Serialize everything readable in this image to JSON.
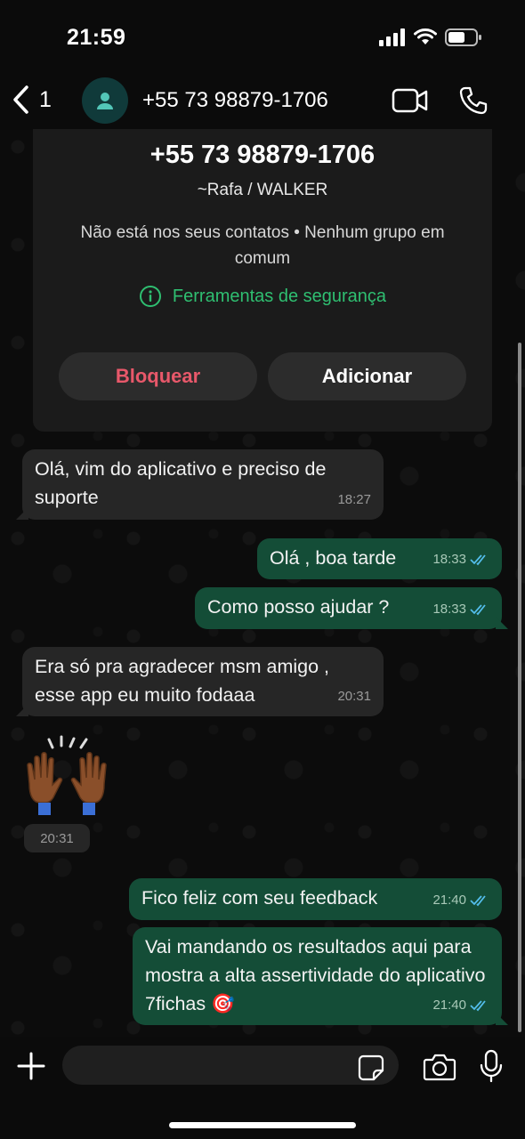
{
  "status_bar": {
    "time": "21:59"
  },
  "header": {
    "back_count": "1",
    "title": "+55 73 98879-1706",
    "icons": [
      "chevron-left-icon",
      "person-icon",
      "video-camera-icon",
      "phone-icon"
    ]
  },
  "info_card": {
    "phone": "+55 73 98879-1706",
    "name": "~Rafa / WALKER",
    "description": "Não está nos seus contatos • Nenhum grupo em comum",
    "security_label": "Ferramentas de segurança",
    "block_label": "Bloquear",
    "add_label": "Adicionar"
  },
  "messages": [
    {
      "direction": "in",
      "text": "Olá, vim do aplicativo e preciso de suporte",
      "time": "18:27"
    },
    {
      "direction": "out",
      "text": "Olá , boa tarde",
      "time": "18:33",
      "status": "read"
    },
    {
      "direction": "out",
      "text": "Como posso ajudar ?",
      "time": "18:33",
      "status": "read"
    },
    {
      "direction": "in",
      "text": "Era só pra agradecer msm amigo , esse app eu muito fodaaa",
      "time": "20:31"
    },
    {
      "direction": "in",
      "type": "emoji",
      "text": "🙌🏾",
      "time": "20:31"
    },
    {
      "direction": "out",
      "text": "Fico feliz com seu feedback",
      "time": "21:40",
      "status": "read"
    },
    {
      "direction": "out",
      "text": "Vai mandando os resultados aqui para mostra a alta assertividade do aplicativo 7fichas 🎯",
      "time": "21:40",
      "status": "read"
    }
  ],
  "input_bar": {
    "placeholder": "",
    "icons": [
      "plus-icon",
      "sticker-icon",
      "camera-icon",
      "microphone-icon"
    ]
  },
  "colors": {
    "accent_green": "#2fbf71",
    "outgoing_bubble": "#144d37",
    "incoming_bubble": "#262626",
    "block_red": "#e8586a",
    "read_tick_blue": "#53bdeb"
  }
}
